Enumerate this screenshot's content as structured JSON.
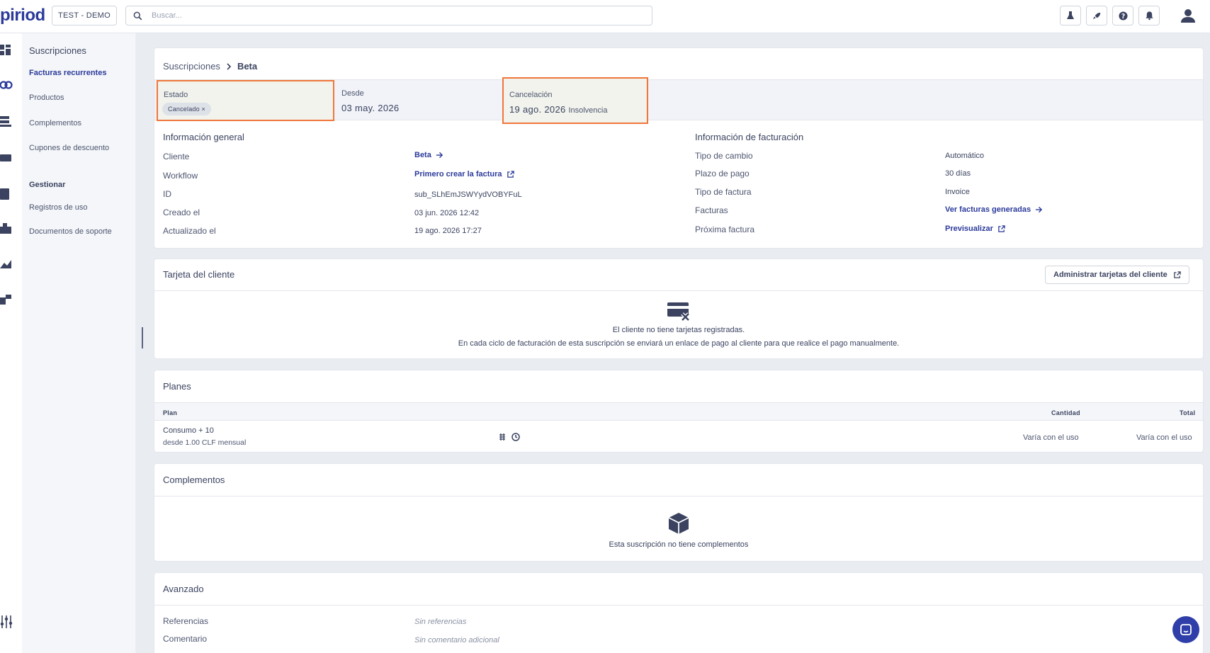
{
  "topbar": {
    "logo": "piriod",
    "environment": "TEST - DEMO",
    "search_placeholder": "Buscar...",
    "icons": [
      "lab-icon",
      "rocket-icon",
      "help-icon",
      "bell-icon",
      "user-icon"
    ]
  },
  "nav": {
    "section_title": "Suscripciones",
    "items": [
      {
        "label": "Facturas recurrentes",
        "active": true
      },
      {
        "label": "Productos",
        "active": false
      },
      {
        "label": "Complementos",
        "active": false
      },
      {
        "label": "Cupones de descuento",
        "active": false
      }
    ],
    "manage_title": "Gestionar",
    "manage_items": [
      {
        "label": "Registros de uso"
      },
      {
        "label": "Documentos de soporte"
      }
    ]
  },
  "breadcrumb": {
    "parent": "Suscripciones",
    "current": "Beta"
  },
  "status_strip": {
    "estado_label": "Estado",
    "estado_value": "Cancelado",
    "desde_label": "Desde",
    "desde_value": "03 may. 2026",
    "cancel_label": "Cancelación",
    "cancel_value": "19 ago. 2026",
    "cancel_reason": "Insolvencia"
  },
  "general": {
    "title": "Información general",
    "rows": [
      {
        "label": "Cliente",
        "value": "Beta"
      },
      {
        "label": "Workflow",
        "value": "Primero crear la factura"
      },
      {
        "label": "ID",
        "value": "sub_SLhEmJSWYydVOBYFuL"
      },
      {
        "label": "Creado el",
        "value": "03 jun. 2026 12:42"
      },
      {
        "label": "Actualizado el",
        "value": "19 ago. 2026 17:27"
      }
    ]
  },
  "billing": {
    "title": "Información de facturación",
    "rows": [
      {
        "label": "Tipo de cambio",
        "value": "Automático"
      },
      {
        "label": "Plazo de pago",
        "value": "30 días"
      },
      {
        "label": "Tipo de factura",
        "value": "Invoice"
      },
      {
        "label": "Facturas",
        "value": "Ver facturas generadas"
      },
      {
        "label": "Próxima factura",
        "value": "Previsualizar"
      }
    ]
  },
  "card_section": {
    "title": "Tarjeta del cliente",
    "button": "Administrar tarjetas del cliente",
    "empty_line1": "El cliente no tiene tarjetas registradas.",
    "empty_line2": "En cada ciclo de facturación de esta suscripción se enviará un enlace de pago al cliente para que realice el pago manualmente."
  },
  "plans": {
    "title": "Planes",
    "headers": {
      "plan": "Plan",
      "cantidad": "Cantidad",
      "total": "Total"
    },
    "rows": [
      {
        "name": "Consumo + 10",
        "sub": "desde 1.00 CLF mensual",
        "cantidad": "Varía con el uso",
        "total": "Varía con el uso"
      }
    ]
  },
  "addons": {
    "title": "Complementos",
    "empty": "Esta suscripción no tiene complementos"
  },
  "advanced": {
    "title": "Avanzado",
    "rows": [
      {
        "label": "Referencias",
        "value": "Sin referencias"
      },
      {
        "label": "Comentario",
        "value": "Sin comentario adicional"
      }
    ]
  },
  "colors": {
    "accent": "#2b3a9a",
    "highlight": "#f0763a"
  }
}
